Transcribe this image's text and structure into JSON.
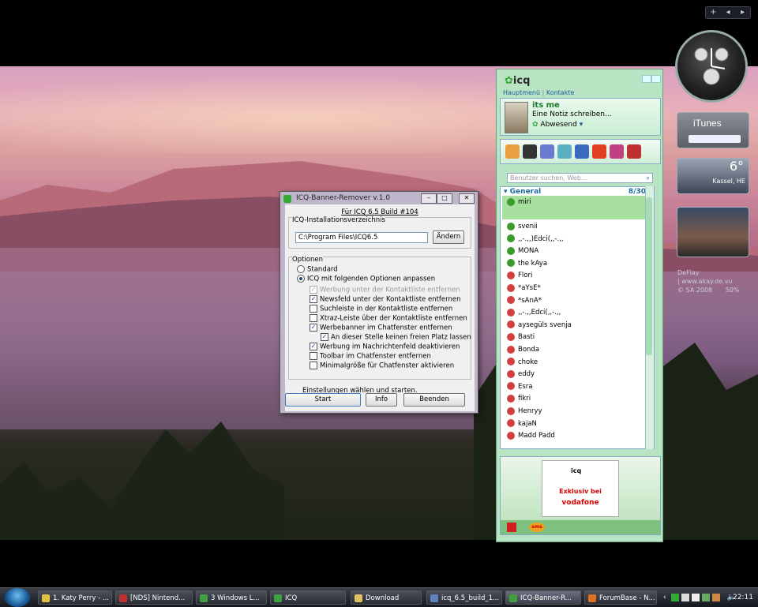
{
  "sidebar_controls": {
    "add": "+",
    "prev": "◂",
    "next": "▸"
  },
  "itunes": {
    "label": "iTunes"
  },
  "weather": {
    "temp": "6°",
    "city": "Kassel, HE"
  },
  "text_gadget": {
    "line1": "DeFlay",
    "line2": "| www.akay.de.vu",
    "line3": "© SA 2008",
    "line4": "50%"
  },
  "icq": {
    "logo": "icq",
    "menu": {
      "main": "Hauptmenü",
      "contacts": "Kontakte"
    },
    "profile": {
      "name": "its me",
      "note": "Eine Notiz schreiben...",
      "status": "Abwesend"
    },
    "search_placeholder": "Benutzer suchen, Web...",
    "group": {
      "name": "General",
      "count": "8/30"
    },
    "contacts": [
      "miri",
      "svenii",
      ",,-.,,)Edci(,,-.,,",
      "MONA",
      "the kAya",
      "Flori",
      "*aYsE*",
      "*sAnA*",
      ",,-.,,Edci(,,-.,,",
      "aysegüls svenja",
      "Basti",
      "Bonda",
      "choke",
      "eddy",
      "Esra",
      "fikri",
      "Henryy",
      "kajaN",
      "Madd Padd"
    ],
    "ad": {
      "line1": "Exklusiv bei",
      "brand": "vodafone",
      "box_logo": "icq"
    },
    "tab_sms": "sms"
  },
  "dialog": {
    "title": "ICQ-Banner-Remover v.1.0",
    "header": "Für ICQ 6.5 Build #104",
    "install_label": "ICQ-Installationsverzeichnis",
    "install_path": "C:\\Program Files\\ICQ6.5",
    "change_button": "Ändern",
    "options_label": "Optionen",
    "radio_standard": "Standard",
    "radio_custom": "ICQ mit folgenden Optionen anpassen",
    "options": [
      {
        "label": "Werbung unter der Kontaktliste entfernen",
        "checked": true,
        "disabled": true,
        "indent": 1
      },
      {
        "label": "Newsfeld unter der Kontaktliste entfernen",
        "checked": true,
        "disabled": false,
        "indent": 1
      },
      {
        "label": "Suchleiste in der Kontaktliste entfernen",
        "checked": false,
        "disabled": false,
        "indent": 1
      },
      {
        "label": "Xtraz-Leiste über der Kontaktliste entfernen",
        "checked": false,
        "disabled": false,
        "indent": 1
      },
      {
        "label": "Werbebanner im Chatfenster entfernen",
        "checked": true,
        "disabled": false,
        "indent": 1
      },
      {
        "label": "An dieser Stelle keinen freien Platz lassen",
        "checked": true,
        "disabled": false,
        "indent": 2
      },
      {
        "label": "Werbung im Nachrichtenfeld deaktivieren",
        "checked": true,
        "disabled": false,
        "indent": 1
      },
      {
        "label": "Toolbar im Chatfenster entfernen",
        "checked": false,
        "disabled": false,
        "indent": 1
      },
      {
        "label": "Minimalgröße für Chatfenster aktivieren",
        "checked": false,
        "disabled": false,
        "indent": 1
      }
    ],
    "footer_text": "Einstellungen wählen und starten.",
    "start_button": "Start",
    "info_button": "Info",
    "quit_button": "Beenden"
  },
  "taskbar": {
    "tasks": [
      {
        "label": "1. Katy Perry - ...",
        "color": "#e0c040"
      },
      {
        "label": "[NDS] Nintend...",
        "color": "#c03030"
      },
      {
        "label": "3 Windows L...",
        "color": "#40a040"
      },
      {
        "label": "ICQ",
        "color": "#40a040"
      },
      {
        "label": "Download",
        "color": "#e0c060"
      },
      {
        "label": "icq_6.5_build_1...",
        "color": "#6080c0"
      },
      {
        "label": "ICQ-Banner-R...",
        "color": "#40a040"
      },
      {
        "label": "ForumBase - N...",
        "color": "#e07020"
      }
    ],
    "clock": "22:11"
  }
}
